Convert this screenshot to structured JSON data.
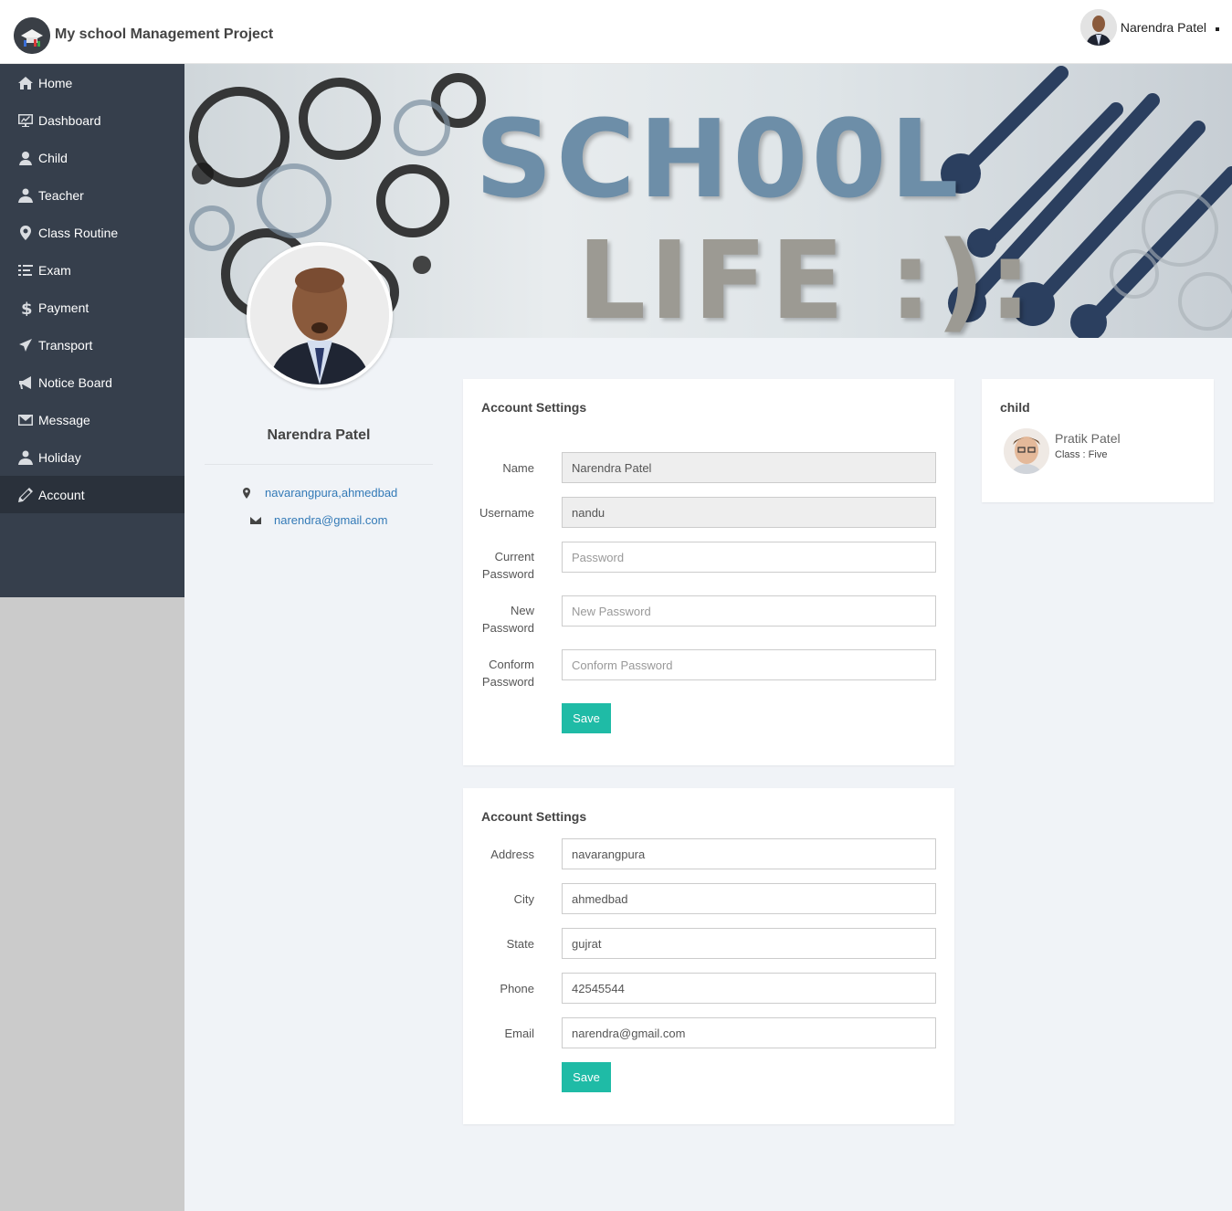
{
  "app": {
    "title": "My school Management Project"
  },
  "user": {
    "name": "Narendra Patel"
  },
  "sidebar": {
    "items": [
      {
        "label": "Home",
        "icon": "home-icon"
      },
      {
        "label": "Dashboard",
        "icon": "dashboard-icon"
      },
      {
        "label": "Child",
        "icon": "child-icon"
      },
      {
        "label": "Teacher",
        "icon": "teacher-icon"
      },
      {
        "label": "Class Routine",
        "icon": "map-marker-icon"
      },
      {
        "label": "Exam",
        "icon": "list-icon"
      },
      {
        "label": "Payment",
        "icon": "dollar-icon"
      },
      {
        "label": "Transport",
        "icon": "plane-icon"
      },
      {
        "label": "Notice Board",
        "icon": "bullhorn-icon"
      },
      {
        "label": "Message",
        "icon": "envelope-icon"
      },
      {
        "label": "Holiday",
        "icon": "user-icon"
      },
      {
        "label": "Account",
        "icon": "pencil-icon"
      }
    ],
    "active": "Account"
  },
  "banner": {
    "line1": "SCH00L",
    "line2": "LIFE :):"
  },
  "profile": {
    "name": "Narendra Patel",
    "address": "navarangpura,ahmedbad",
    "email": "narendra@gmail.com"
  },
  "account_form": {
    "title": "Account Settings",
    "name_label": "Name",
    "name_value": "Narendra Patel",
    "username_label": "Username",
    "username_value": "nandu",
    "current_password_label_1": "Current",
    "current_password_label_2": "Password",
    "current_password_placeholder": "Password",
    "new_password_label_1": "New",
    "new_password_label_2": "Password",
    "new_password_placeholder": "New Password",
    "confirm_password_label_1": "Conform",
    "confirm_password_label_2": "Password",
    "confirm_password_placeholder": "Conform Password",
    "save_label": "Save"
  },
  "contact_form": {
    "title": "Account Settings",
    "address_label": "Address",
    "address_value": "navarangpura",
    "city_label": "City",
    "city_value": "ahmedbad",
    "state_label": "State",
    "state_value": "gujrat",
    "phone_label": "Phone",
    "phone_value": "42545544",
    "email_label": "Email",
    "email_value": "narendra@gmail.com",
    "save_label": "Save"
  },
  "child_panel": {
    "title": "child",
    "name": "Pratik Patel",
    "class": "Class : Five"
  },
  "colors": {
    "sidebar": "#363f4c",
    "sidebar_active": "#2a313b",
    "accent_button": "#1fbba6",
    "link": "#337ab7",
    "page_bg": "#f0f3f7"
  }
}
